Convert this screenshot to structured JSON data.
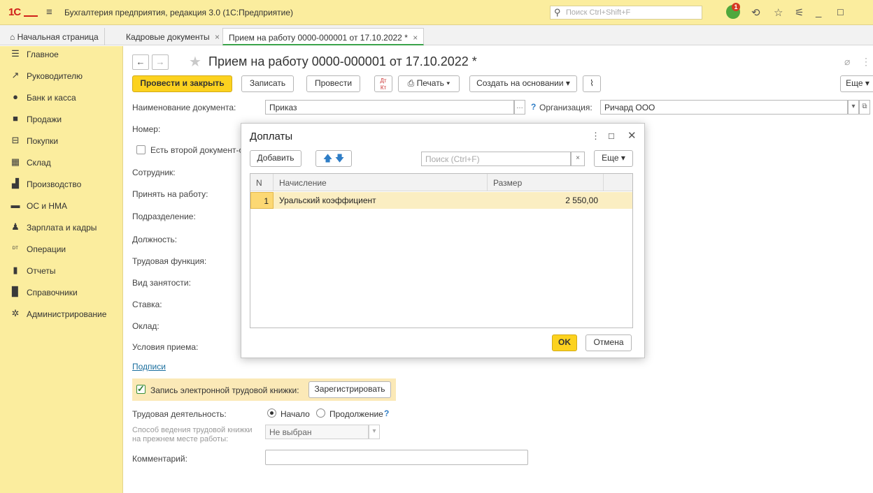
{
  "app": {
    "title": "Бухгалтерия предприятия, редакция 3.0  (1С:Предприятие)",
    "logo": "1С",
    "search_placeholder": "Поиск Ctrl+Shift+F",
    "notifications_count": "1"
  },
  "tabs": [
    {
      "label": "Начальная страница"
    },
    {
      "label": "Кадровые документы"
    },
    {
      "label": "Прием на работу 0000-000001 от 17.10.2022 *"
    }
  ],
  "sidebar": {
    "items": [
      {
        "label": "Главное",
        "icon": "menu-icon"
      },
      {
        "label": "Руководителю",
        "icon": "trend-icon"
      },
      {
        "label": "Банк и касса",
        "icon": "coin-icon"
      },
      {
        "label": "Продажи",
        "icon": "bag-icon"
      },
      {
        "label": "Покупки",
        "icon": "cart-icon"
      },
      {
        "label": "Склад",
        "icon": "warehouse-icon"
      },
      {
        "label": "Производство",
        "icon": "factory-icon"
      },
      {
        "label": "ОС и НМА",
        "icon": "truck-icon"
      },
      {
        "label": "Зарплата и кадры",
        "icon": "person-icon"
      },
      {
        "label": "Операции",
        "icon": "dt-kt-icon"
      },
      {
        "label": "Отчеты",
        "icon": "bar-chart-icon"
      },
      {
        "label": "Справочники",
        "icon": "book-icon"
      },
      {
        "label": "Администрирование",
        "icon": "gear-icon"
      }
    ]
  },
  "document": {
    "title": "Прием на работу 0000-000001 от 17.10.2022 *",
    "toolbar": {
      "post_close": "Провести и закрыть",
      "save": "Записать",
      "post": "Провести",
      "dt_kt": "Дт Кт",
      "print": "Печать",
      "create_based": "Создать на основании",
      "more": "Еще"
    },
    "fields": {
      "doc_name_label": "Наименование документа:",
      "doc_name_value": "Приказ",
      "org_label": "Организация:",
      "org_value": "Ричард ООО",
      "number_label": "Номер:",
      "second_doc_label": "Есть второй документ-о",
      "employee_label": "Сотрудник:",
      "hire_date_label": "Принять на работу:",
      "department_label": "Подразделение:",
      "position_label": "Должность:",
      "labor_function_label": "Трудовая функция:",
      "employment_type_label": "Вид занятости:",
      "rate_label": "Ставка:",
      "salary_label": "Оклад:",
      "conditions_label": "Условия приема:",
      "signatures_link": "Подписи",
      "ek_label": "Запись электронной трудовой книжки:",
      "register_button": "Зарегистрировать",
      "work_activity_label": "Трудовая деятельность:",
      "radio_start": "Начало",
      "radio_continue": "Продолжение",
      "method_label_1": "Способ ведения трудовой книжки",
      "method_label_2": "на прежнем месте работы:",
      "method_value": "Не выбран",
      "comment_label": "Комментарий:",
      "comment_value": ""
    }
  },
  "dialog": {
    "title": "Доплаты",
    "add_button": "Добавить",
    "search_placeholder": "Поиск (Ctrl+F)",
    "more_button": "Еще",
    "columns": [
      "N",
      "Начисление",
      "Размер"
    ],
    "rows": [
      {
        "n": "1",
        "accrual": "Уральский коэффициент",
        "amount": "2 550,00"
      }
    ],
    "ok_button": "OK",
    "cancel_button": "Отмена"
  }
}
